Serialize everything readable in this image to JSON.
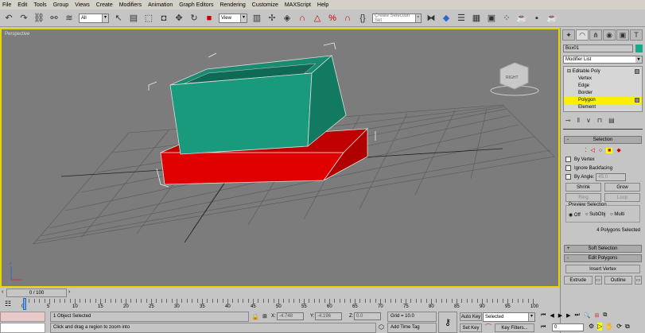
{
  "menu": [
    "File",
    "Edit",
    "Tools",
    "Group",
    "Views",
    "Create",
    "Modifiers",
    "Animation",
    "Graph Editors",
    "Rendering",
    "Customize",
    "MAXScript",
    "Help"
  ],
  "toolbar": {
    "filter": "All",
    "ref_coord": "View",
    "named_selection_placeholder": "Create Selection Set"
  },
  "viewport": {
    "label": "Perspective",
    "viewcube_label": "RIGHT",
    "colors": {
      "top_box": "#1a8a70",
      "base": "#e00000",
      "background": "#7c7c7c",
      "border": "#e3d800"
    }
  },
  "panel": {
    "object_name": "Box01",
    "object_color": "#1aa88a",
    "modifier_list": "Modifier List",
    "stack": [
      {
        "label": "Editable Poly"
      },
      {
        "label": "Vertex"
      },
      {
        "label": "Edge"
      },
      {
        "label": "Border"
      },
      {
        "label": "Polygon",
        "selected": true
      },
      {
        "label": "Element"
      }
    ],
    "selection": {
      "title": "Selection",
      "by_vertex": "By Vertex",
      "ignore_backfacing": "Ignore Backfacing",
      "by_angle": "By Angle:",
      "angle_value": "45.0",
      "shrink": "Shrink",
      "grow": "Grow",
      "ring": "Ring",
      "loop": "Loop",
      "preview_title": "Preview Selection",
      "preview_options": [
        "Off",
        "SubObj",
        "Multi"
      ],
      "preview_selected": "Off",
      "status": "4 Polygons Selected"
    },
    "soft_selection": "Soft Selection",
    "edit_polygons": {
      "title": "Edit Polygons",
      "insert_vertex": "Insert Vertex",
      "extrude": "Extrude",
      "outline": "Outline"
    }
  },
  "timeline": {
    "frame": "0 / 100",
    "ticks": [
      "0",
      "5",
      "10",
      "15",
      "20",
      "25",
      "30",
      "35",
      "40",
      "45",
      "50",
      "55",
      "60",
      "65",
      "70",
      "75",
      "80",
      "85",
      "90",
      "95",
      "100"
    ]
  },
  "status": {
    "selection": "1 Object Selected",
    "prompt": "Click and drag a region to zoom into",
    "x_label": "X:",
    "x": "-4.748",
    "y_label": "Y:",
    "y": "-4.196",
    "z_label": "Z:",
    "z": "0.0",
    "grid": "Grid = 10.0",
    "add_time_tag": "Add Time Tag",
    "auto_key": "Auto Key",
    "set_key": "Set Key",
    "key_mode": "Selected",
    "key_filters": "Key Filters...",
    "current_frame": "0"
  }
}
